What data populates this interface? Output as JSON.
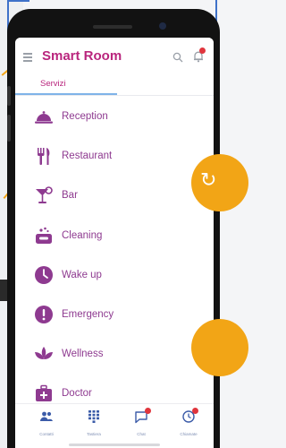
{
  "app": {
    "title": "Smart Room",
    "tab": "Servizi"
  },
  "services": [
    {
      "label": "Reception",
      "icon": "bell-service-icon"
    },
    {
      "label": "Restaurant",
      "icon": "fork-knife-icon"
    },
    {
      "label": "Bar",
      "icon": "cocktail-icon"
    },
    {
      "label": "Cleaning",
      "icon": "cleaning-icon"
    },
    {
      "label": "Wake up",
      "icon": "clock-icon"
    },
    {
      "label": "Emergency",
      "icon": "alert-icon"
    },
    {
      "label": "Wellness",
      "icon": "lotus-icon"
    },
    {
      "label": "Doctor",
      "icon": "medical-bag-icon"
    }
  ],
  "nav": [
    {
      "label": "Contatti",
      "icon": "people-icon"
    },
    {
      "label": "Tastiera",
      "icon": "keypad-icon"
    },
    {
      "label": "Chat",
      "icon": "chat-icon"
    },
    {
      "label": "Chiamate",
      "icon": "call-history-icon"
    }
  ],
  "colors": {
    "accent": "#b9257d",
    "icon": "#8e3a90",
    "overlay": "#f2a516",
    "badge": "#e0353d"
  }
}
